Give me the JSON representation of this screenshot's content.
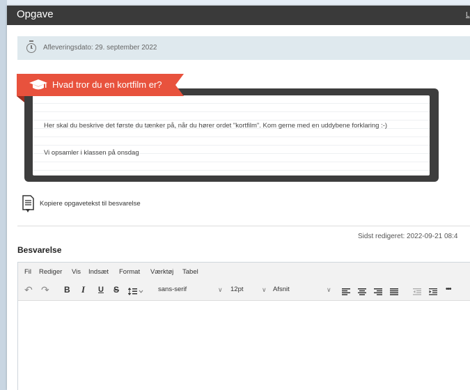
{
  "window": {
    "title": "Opgave",
    "close_link": "L"
  },
  "deadline": {
    "text": "Afleveringsdato: 29. september 2022",
    "icon": "clock-icon"
  },
  "assignment": {
    "banner_title": "Hvad tror du en kortfilm er?",
    "banner_icon": "graduation-cap-icon",
    "banner_color": "#e8523d",
    "paragraphs": [
      "Her skal du beskrive det første du tænker på, når du hører ordet \"kortfilm\". Kom gerne med en uddybene forklaring :-)",
      "Vi opsamler i klassen på onsdag"
    ]
  },
  "copy_action": {
    "label": "Kopiere opgavetekst til besvarelse",
    "icon": "copy-document-icon"
  },
  "answer": {
    "last_edited": "Sidst redigeret: 2022-09-21 08:4",
    "heading": "Besvarelse"
  },
  "editor": {
    "menus": [
      "Fil",
      "Rediger",
      "Vis",
      "Indsæt",
      "Format",
      "Værktøj",
      "Tabel"
    ],
    "toolbar": {
      "undo": "↶",
      "redo": "↷",
      "bold": "B",
      "italic": "I",
      "underline": "U",
      "strikethrough": "S",
      "font_family": "sans-serif",
      "font_size": "12pt",
      "block_format": "Afsnit",
      "more": "•••"
    }
  }
}
